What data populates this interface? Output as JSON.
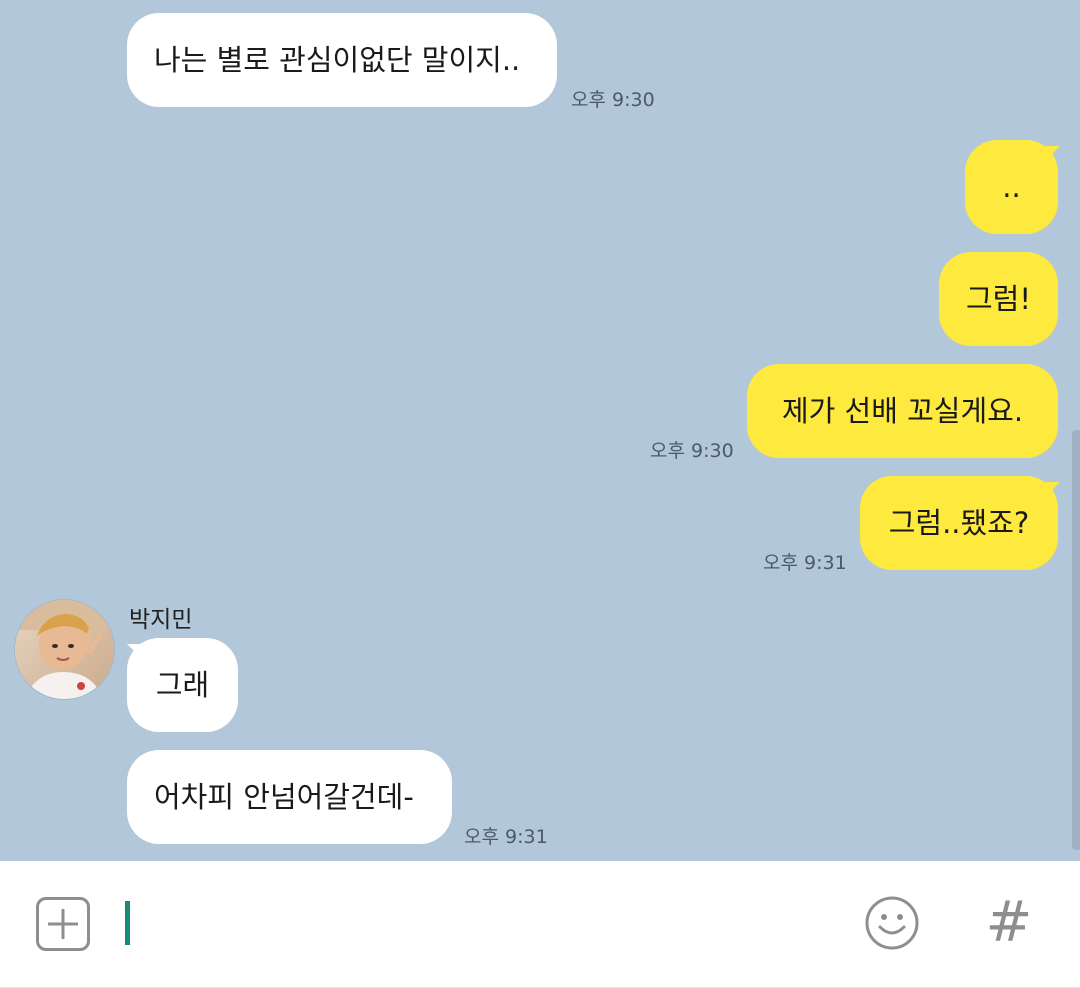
{
  "messages": [
    {
      "text": "나는 별로 관심이없단 말이지..",
      "direction": "in"
    },
    {
      "text": "..",
      "direction": "out"
    },
    {
      "text": "그럼!",
      "direction": "out"
    },
    {
      "text": "제가 선배 꼬실게요.",
      "direction": "out"
    },
    {
      "text": "그럼..됐죠?",
      "direction": "out"
    },
    {
      "text": "그래",
      "direction": "in"
    },
    {
      "text": "어차피 안넘어갈건데-",
      "direction": "in"
    }
  ],
  "timestamps": {
    "t1": "오후 9:30",
    "t2": "오후 9:30",
    "t3": "오후 9:31",
    "t4": "오후 9:31"
  },
  "sender": {
    "name": "박지민",
    "avatar_icon": "profile-photo"
  },
  "input_bar": {
    "message_value": "",
    "plus_icon": "plus-square-icon",
    "emoji_icon": "smiley-icon",
    "hash_label": "#"
  },
  "colors": {
    "chat_background": "#b2c7da",
    "outgoing_bubble": "#fee93e",
    "incoming_bubble": "#ffffff",
    "caret": "#1b8a7a"
  }
}
